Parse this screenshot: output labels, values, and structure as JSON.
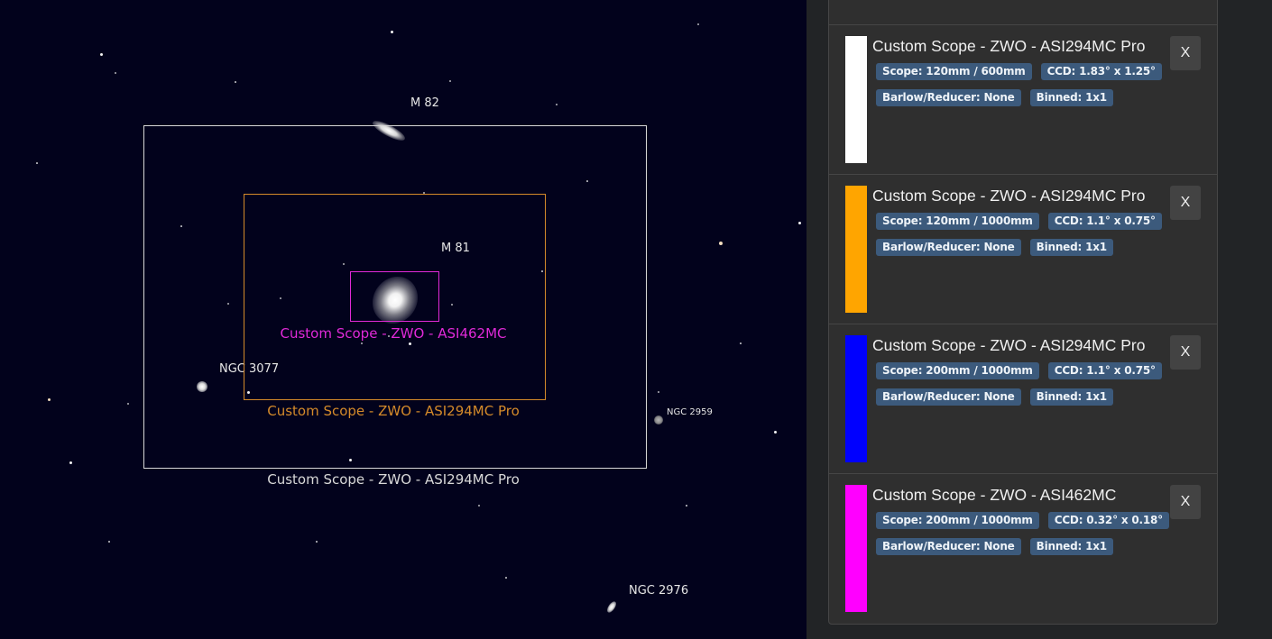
{
  "sky": {
    "objects": [
      {
        "id": "m82",
        "label": "M 82"
      },
      {
        "id": "m81",
        "label": "M 81"
      },
      {
        "id": "ngc3077",
        "label": "NGC 3077"
      },
      {
        "id": "ngc2959",
        "label": "NGC 2959"
      },
      {
        "id": "ngc2976",
        "label": "NGC 2976"
      }
    ],
    "fov_labels": [
      {
        "label": "Custom Scope - ZWO - ASI294MC Pro",
        "color": "#d8d8d8"
      },
      {
        "label": "Custom Scope - ZWO - ASI294MC Pro",
        "color": "#d48a2a"
      },
      {
        "label": "Custom Scope - ZWO - ASI462MC",
        "color": "#e02ad8"
      }
    ]
  },
  "fov_list": [
    {
      "color": "#ffffff",
      "title": "Custom Scope - ZWO - ASI294MC Pro",
      "scope": "Scope: 120mm / 600mm",
      "ccd": "CCD: 1.83° x 1.25°",
      "barlow": "Barlow/Reducer: None",
      "binned": "Binned: 1x1",
      "remove_label": "X"
    },
    {
      "color": "#ffa500",
      "title": "Custom Scope - ZWO - ASI294MC Pro",
      "scope": "Scope: 120mm / 1000mm",
      "ccd": "CCD: 1.1° x 0.75°",
      "barlow": "Barlow/Reducer: None",
      "binned": "Binned: 1x1",
      "remove_label": "X"
    },
    {
      "color": "#0000ff",
      "title": "Custom Scope - ZWO - ASI294MC Pro",
      "scope": "Scope: 200mm / 1000mm",
      "ccd": "CCD: 1.1° x 0.75°",
      "barlow": "Barlow/Reducer: None",
      "binned": "Binned: 1x1",
      "remove_label": "X"
    },
    {
      "color": "#ff00ff",
      "title": "Custom Scope - ZWO - ASI462MC",
      "scope": "Scope: 200mm / 1000mm",
      "ccd": "CCD: 0.32° x 0.18°",
      "barlow": "Barlow/Reducer: None",
      "binned": "Binned: 1x1",
      "remove_label": "X"
    }
  ]
}
